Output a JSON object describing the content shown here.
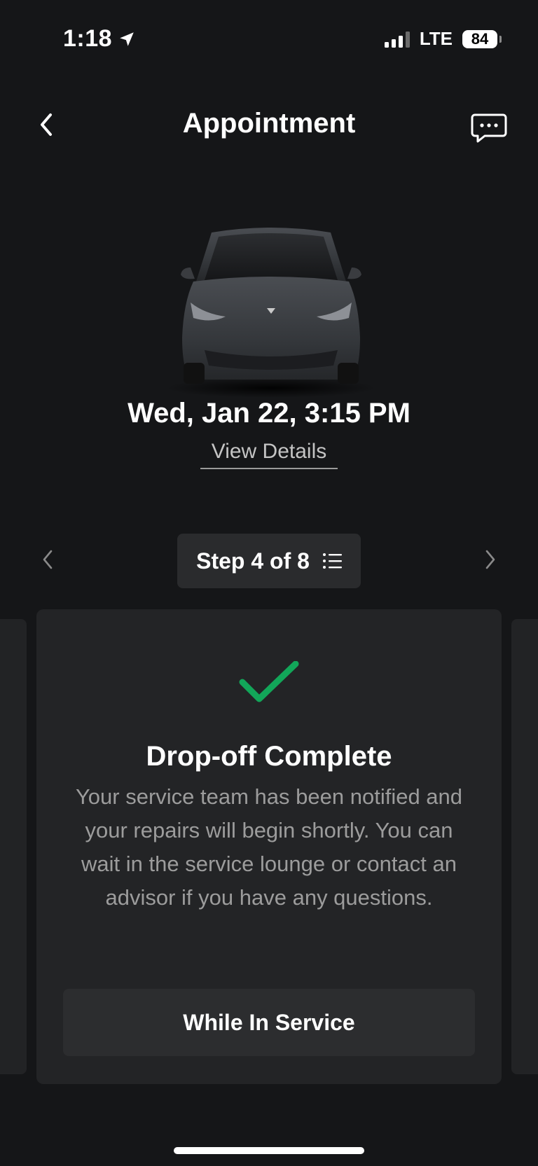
{
  "status_bar": {
    "time": "1:18",
    "network": "LTE",
    "battery": "84",
    "location_icon": "location-arrow-icon",
    "signal_icon": "cellular-signal-icon"
  },
  "nav": {
    "title": "Appointment",
    "back_icon": "chevron-left-icon",
    "chat_icon": "chat-bubble-icon"
  },
  "appointment": {
    "date": "Wed, Jan 22, 3:15 PM",
    "view_details": "View Details"
  },
  "step": {
    "label": "Step 4 of 8",
    "list_icon": "list-icon",
    "prev_icon": "chevron-left-icon",
    "next_icon": "chevron-right-icon"
  },
  "card": {
    "status_icon": "checkmark-icon",
    "title": "Drop-off Complete",
    "body": "Your service team has been notified and your repairs will begin shortly. You can wait in the service lounge or contact an advisor if you have any questions.",
    "button": "While In Service"
  },
  "colors": {
    "background": "#151618",
    "card": "#232426",
    "accent_green": "#12a659",
    "muted_text": "#9c9c9c"
  }
}
